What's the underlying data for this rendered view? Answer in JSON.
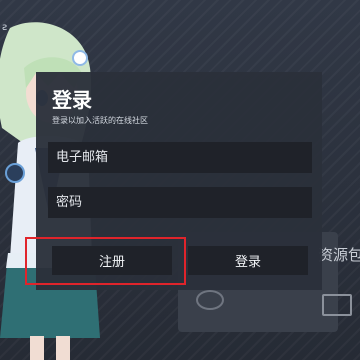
{
  "background": {
    "tile_label": "资源包",
    "top_glyph": "ƨ"
  },
  "dialog": {
    "title": "登录",
    "subtitle": "登录以加入活跃的在线社区",
    "email": {
      "placeholder": "电子邮箱",
      "value": ""
    },
    "password": {
      "placeholder": "密码",
      "value": ""
    },
    "register_label": "注册",
    "login_label": "登录"
  },
  "colors": {
    "highlight": "#e0242b",
    "dialog_bg": "#2b303a",
    "field_bg": "#1f2229"
  }
}
